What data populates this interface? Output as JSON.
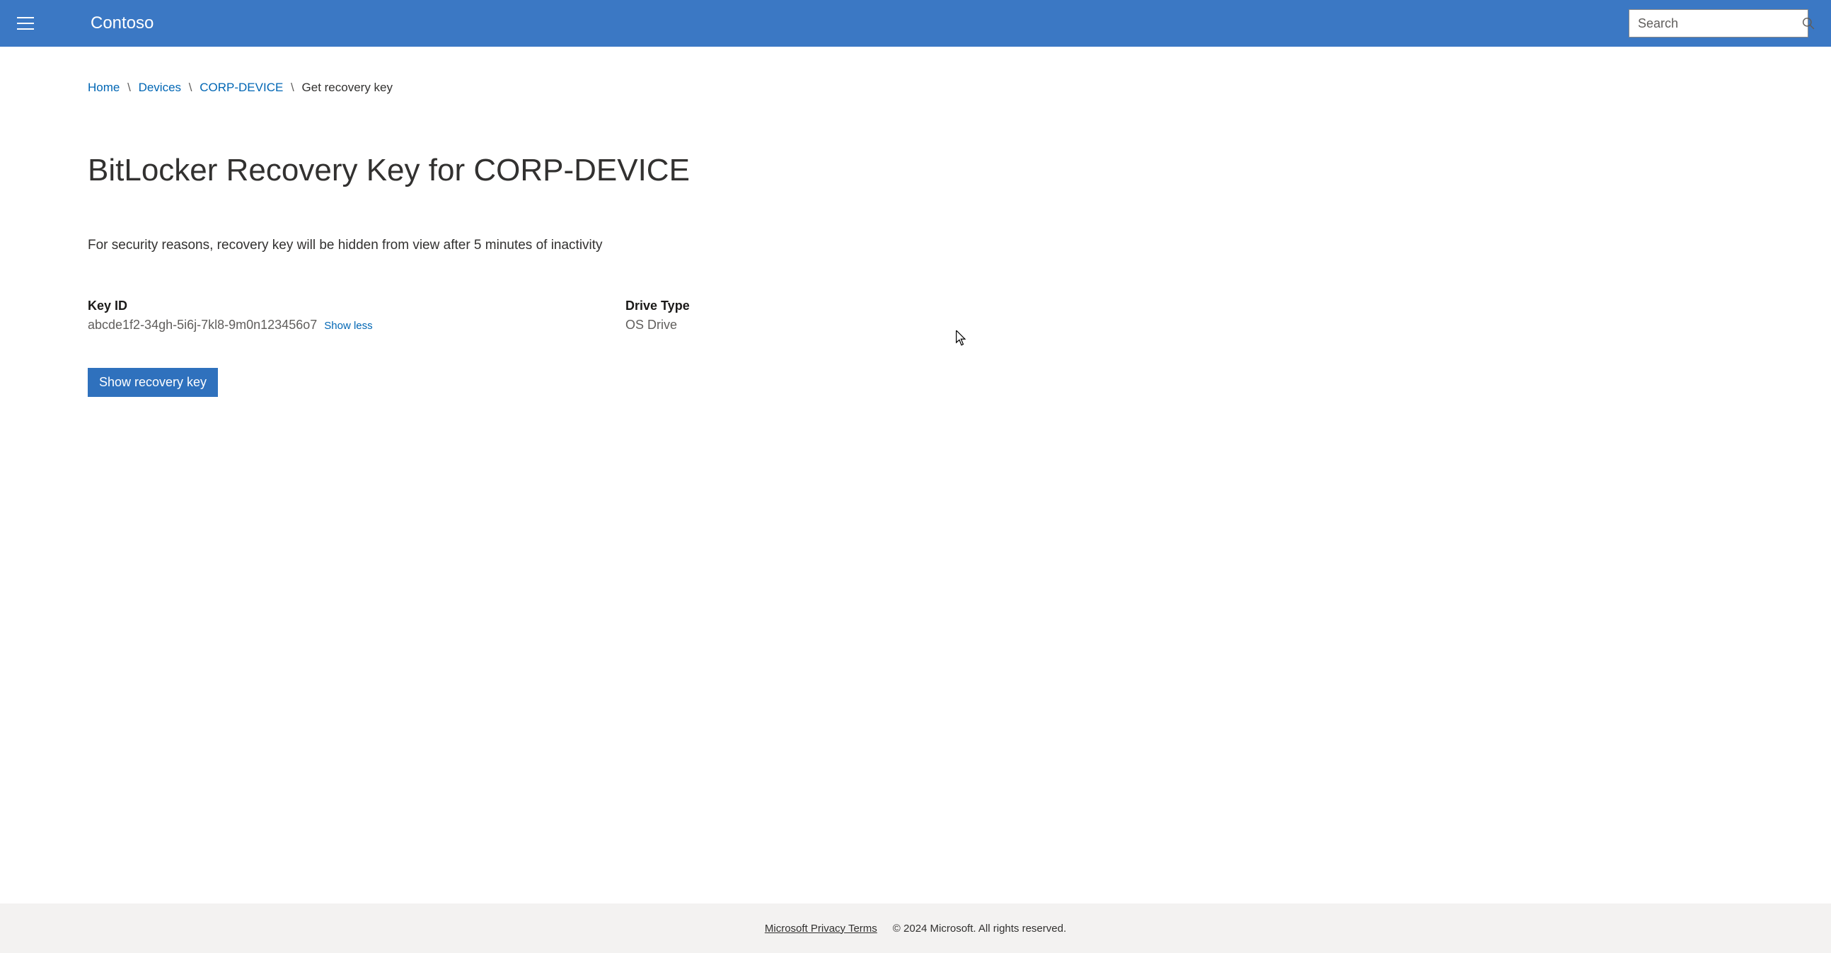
{
  "header": {
    "brand": "Contoso",
    "search_placeholder": "Search"
  },
  "breadcrumb": {
    "items": [
      {
        "label": "Home",
        "link": true
      },
      {
        "label": "Devices",
        "link": true
      },
      {
        "label": "CORP-DEVICE",
        "link": true
      },
      {
        "label": "Get recovery key",
        "link": false
      }
    ]
  },
  "page": {
    "title": "BitLocker Recovery Key for CORP-DEVICE",
    "notice": "For security reasons, recovery key will be hidden from view after 5 minutes of inactivity"
  },
  "details": {
    "key_id": {
      "label": "Key ID",
      "value": "abcde1f2-34gh-5i6j-7kl8-9m0n123456o7",
      "toggle": "Show less"
    },
    "drive_type": {
      "label": "Drive Type",
      "value": "OS Drive"
    }
  },
  "actions": {
    "show_key": "Show recovery key"
  },
  "footer": {
    "privacy_link": "Microsoft Privacy Terms",
    "copyright": "© 2024 Microsoft. All rights reserved."
  }
}
